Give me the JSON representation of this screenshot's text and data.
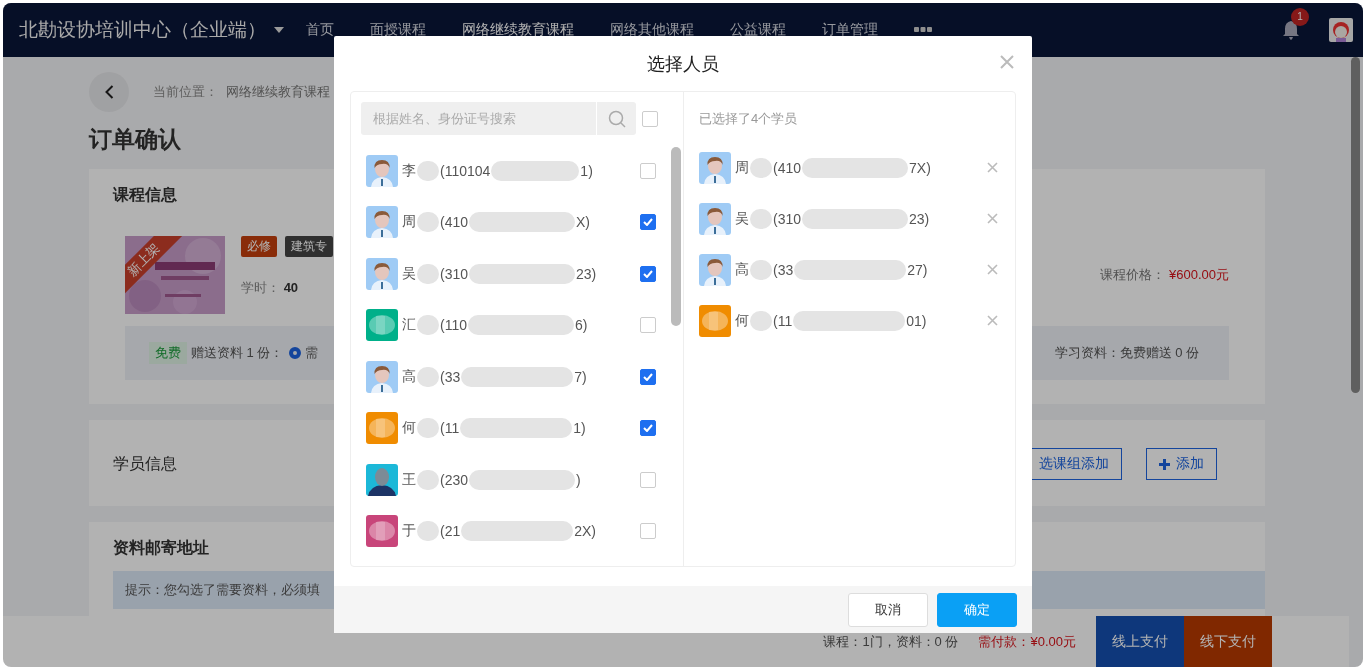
{
  "nav": {
    "brand": "北勘设协培训中心（企业端）",
    "items": [
      {
        "label": "首页",
        "selected": false
      },
      {
        "label": "面授课程",
        "selected": false
      },
      {
        "label": "网络继续教育课程",
        "selected": true
      },
      {
        "label": "网络其他课程",
        "selected": false
      },
      {
        "label": "公益课程",
        "selected": false
      },
      {
        "label": "订单管理",
        "selected": false
      }
    ],
    "notifications": "1"
  },
  "page": {
    "breadcrumb_label": "当前位置：",
    "breadcrumb": "网络继续教育课程",
    "title": "订单确认",
    "course_card": {
      "heading": "课程信息",
      "ribbon": "新上架",
      "tags": [
        {
          "label": "必修",
          "kind": "required"
        },
        {
          "label": "建筑专",
          "kind": "category"
        }
      ],
      "hours_label": "学时：",
      "hours": "40",
      "price_label": "课程价格：",
      "price": "¥600.00元",
      "gift": {
        "badge": "免费",
        "label": "赠送资料 1 份：",
        "option": {
          "label": "需",
          "selected": true
        },
        "materials": "学习资料：免费赠送 0 份"
      }
    },
    "students_card": {
      "heading": "学员信息",
      "group_button": "选课组添加",
      "add_button": "添加"
    },
    "address_card": {
      "heading": "资料邮寄地址",
      "hint": "提示：您勾选了需要资料，必须填"
    },
    "summary": {
      "counts": "课程：1门，资料：0 份",
      "due": "需付款：¥0.00元",
      "buttons": [
        {
          "label": "线上支付",
          "kind": "online"
        },
        {
          "label": "线下支付",
          "kind": "offline"
        }
      ]
    }
  },
  "dialog": {
    "title": "选择人员",
    "search": {
      "placeholder": "根据姓名、身份证号搜索"
    },
    "select_all": {
      "checked": false
    },
    "people": [
      {
        "name": "李",
        "id_head": "(110104",
        "id_tail": "1)",
        "avatar": {
          "kind": "man"
        },
        "checked": false
      },
      {
        "name": "周",
        "id_head": "(410",
        "id_tail": "X)",
        "avatar": {
          "kind": "man"
        },
        "checked": true
      },
      {
        "name": "吴",
        "id_head": "(310",
        "id_tail": "23)",
        "avatar": {
          "kind": "man"
        },
        "checked": true
      },
      {
        "name": "汇",
        "id_head": "(110",
        "id_tail": "6)",
        "avatar": {
          "kind": "blob",
          "color": "#00b08a"
        },
        "checked": false
      },
      {
        "name": "高",
        "id_head": "(33",
        "id_tail": "7)",
        "avatar": {
          "kind": "man"
        },
        "checked": true
      },
      {
        "name": "何",
        "id_head": "(11",
        "id_tail": "1)",
        "avatar": {
          "kind": "blob",
          "color": "#f08c00"
        },
        "checked": true
      },
      {
        "name": "王",
        "id_head": "(230",
        "id_tail": ")",
        "avatar": {
          "kind": "figure",
          "color": "#1cb8d8"
        },
        "checked": false
      },
      {
        "name": "于",
        "id_head": "(21",
        "id_tail": "2X)",
        "avatar": {
          "kind": "blob",
          "color": "#c8457a"
        },
        "checked": false
      }
    ],
    "selected_heading": "已选择了4个学员",
    "chosen": [
      {
        "name": "周",
        "id_head": "(410",
        "id_tail": "7X)",
        "avatar": {
          "kind": "man"
        }
      },
      {
        "name": "吴",
        "id_head": "(310",
        "id_tail": "23)",
        "avatar": {
          "kind": "man"
        }
      },
      {
        "name": "高",
        "id_head": "(33",
        "id_tail": "27)",
        "avatar": {
          "kind": "man"
        }
      },
      {
        "name": "何",
        "id_head": "(11",
        "id_tail": "01)",
        "avatar": {
          "kind": "blob",
          "color": "#f08c00"
        }
      }
    ],
    "cancel_button": "取消",
    "confirm_button": "确定"
  }
}
